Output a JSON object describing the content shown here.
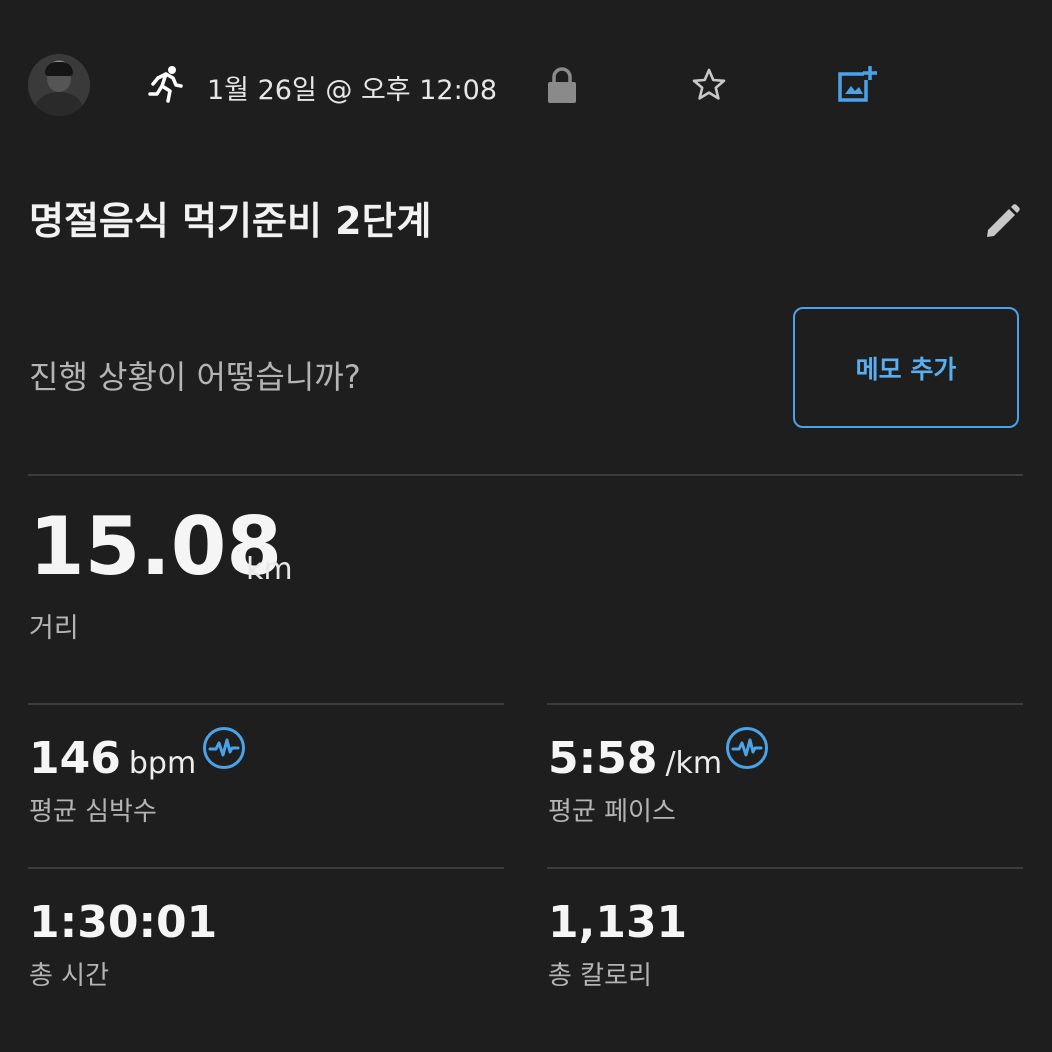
{
  "header": {
    "date": "1월 26일 @ 오후 12:08",
    "icons": [
      "avatar",
      "running-icon",
      "lock-icon",
      "star-icon",
      "add-photo-icon"
    ]
  },
  "activity": {
    "title": "명절음식 먹기준비 2단계",
    "edit_icon": "pencil-icon"
  },
  "notes": {
    "prompt": "진행 상황이 어떻습니까?",
    "add_note_label": "메모 추가"
  },
  "distance": {
    "value": "15.08",
    "unit": "km",
    "label": "거리"
  },
  "stats": {
    "heart_rate": {
      "value": "146",
      "unit": "bpm",
      "label": "평균 심박수",
      "icon": "pulse-icon"
    },
    "pace": {
      "value": "5:58",
      "unit": "/km",
      "label": "평균 페이스",
      "icon": "pulse-icon"
    },
    "total_time": {
      "value": "1:30:01",
      "label": "총 시간"
    },
    "calories": {
      "value": "1,131",
      "label": "총 칼로리"
    }
  },
  "colors": {
    "background": "#1e1e1e",
    "accent": "#4aa3e8",
    "text_primary": "#f5f5f5",
    "text_secondary": "#b4b4b4"
  }
}
